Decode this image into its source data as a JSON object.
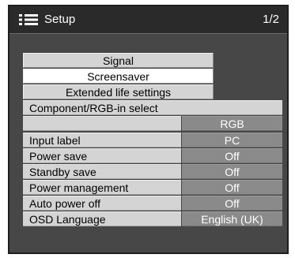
{
  "header": {
    "icon": "menu-list-icon",
    "title": "Setup",
    "page_indicator": "1/2"
  },
  "menu_buttons": [
    {
      "label": "Signal",
      "selected": false
    },
    {
      "label": "Screensaver",
      "selected": true
    },
    {
      "label": "Extended life settings",
      "selected": false
    }
  ],
  "component_rgb": {
    "label": "Component/RGB-in select",
    "value": "RGB"
  },
  "settings": [
    {
      "label": "Input label",
      "value": "PC"
    },
    {
      "label": "Power save",
      "value": "Off"
    },
    {
      "label": "Standby save",
      "value": "Off"
    },
    {
      "label": "Power management",
      "value": "Off"
    },
    {
      "label": "Auto power off",
      "value": "Off"
    },
    {
      "label": "OSD Language",
      "value": "English (UK)"
    }
  ],
  "colors": {
    "panel": "#474747",
    "titlebar": "#2a2a2a",
    "label_bg": "#d4d4d4",
    "value_bg": "#8a8a8a",
    "selected_bg": "#ffffff"
  }
}
